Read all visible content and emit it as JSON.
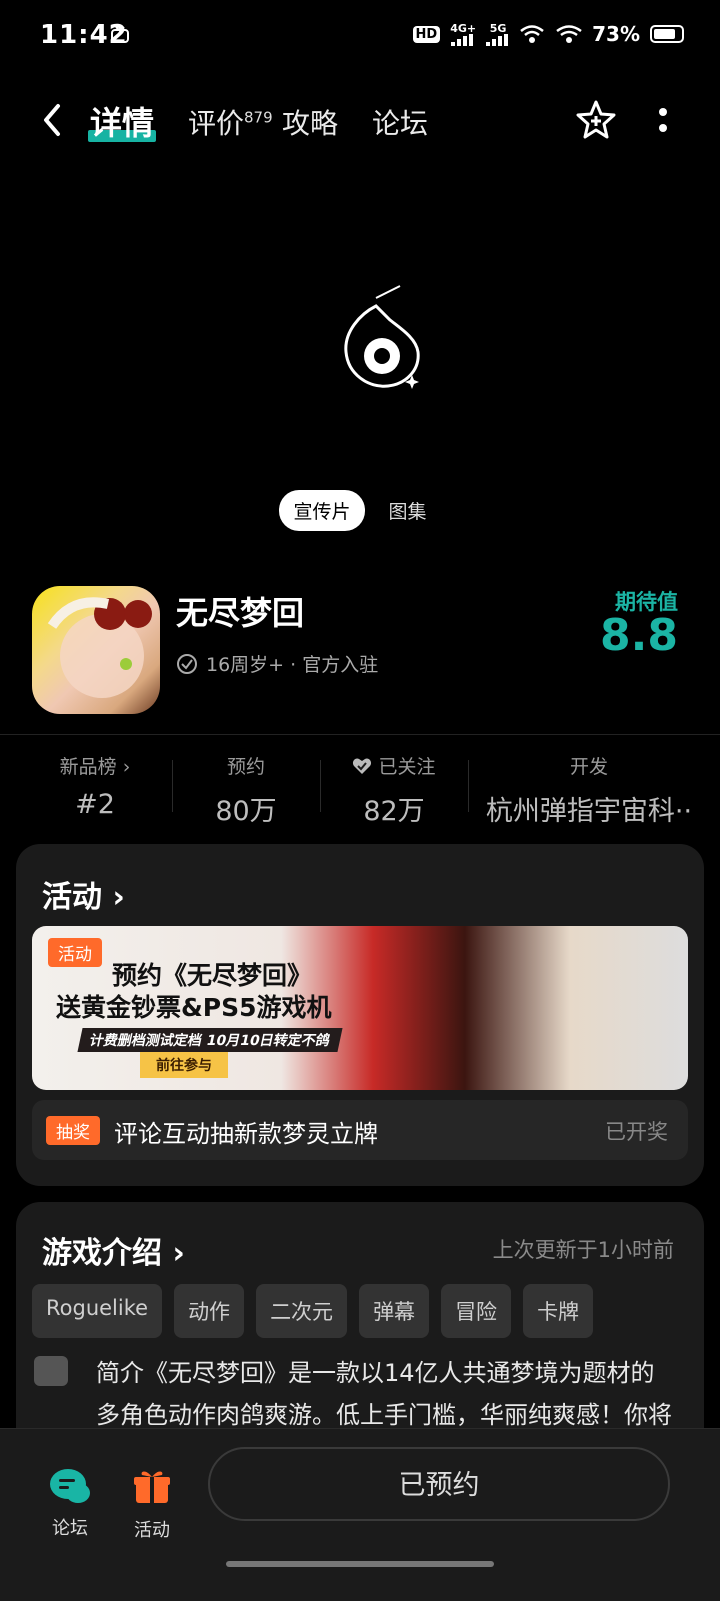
{
  "status": {
    "time": "11:42",
    "net1": "4G+",
    "net2": "5G",
    "hd": "HD",
    "battery": "73%"
  },
  "nav": {
    "tabs": [
      {
        "label": "详情",
        "active": true
      },
      {
        "label": "评价",
        "count": "879"
      },
      {
        "label": "攻略"
      },
      {
        "label": "论坛"
      }
    ]
  },
  "media": {
    "tabs": [
      "宣传片",
      "图集"
    ]
  },
  "app": {
    "name": "无尽梦回",
    "meta": "16周岁+ · 官方入驻",
    "expect_label": "期待值",
    "expect_value": "8.8"
  },
  "stats": [
    {
      "label": "新品榜 ›",
      "value": "#2"
    },
    {
      "label": "预约",
      "value": "80万"
    },
    {
      "label": "已关注",
      "value": "82万"
    },
    {
      "label": "开发",
      "value": "杭州弹指宇宙科··"
    }
  ],
  "activity": {
    "title": "活动 ›",
    "banner": {
      "tag": "活动",
      "line1": "预约《无尽梦回》",
      "line2": "送黄金钞票&PS5游戏机",
      "sub": "计费删档测试定档  10月10日转定不鸽",
      "cta": "前往参与"
    },
    "lottery": {
      "tag": "抽奖",
      "text": "评论互动抽新款梦灵立牌",
      "state": "已开奖"
    }
  },
  "intro": {
    "title": "游戏介绍 ›",
    "updated": "上次更新于1小时前",
    "tags": [
      "Roguelike",
      "动作",
      "二次元",
      "弹幕",
      "冒险",
      "卡牌"
    ],
    "text": "简介《无尽梦回》是一款以14亿人共通梦境为题材的多角色动作肉鸽爽游。低上手门槛，华丽纯爽感！你将在梦境专妻店成为「捕梦者"
  },
  "bottom": {
    "forum": "论坛",
    "activity": "活动",
    "reserve": "已预约"
  },
  "colors": {
    "accent": "#1bb4a4",
    "orange": "#ff6a2a"
  }
}
